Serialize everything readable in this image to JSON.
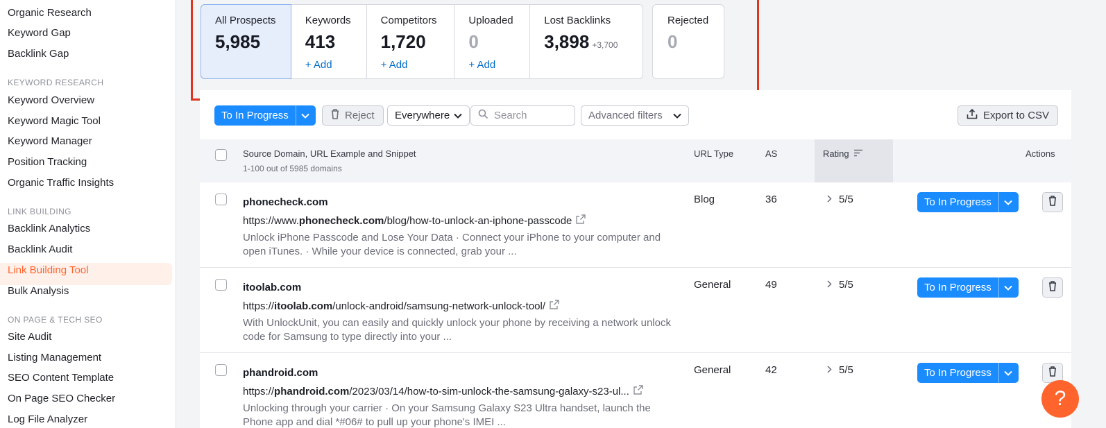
{
  "sidebar": {
    "items_top": [
      "Organic Research",
      "Keyword Gap",
      "Backlink Gap"
    ],
    "section_keyword": "KEYWORD RESEARCH",
    "items_keyword": [
      "Keyword Overview",
      "Keyword Magic Tool",
      "Keyword Manager",
      "Position Tracking",
      "Organic Traffic Insights"
    ],
    "section_link": "LINK BUILDING",
    "items_link": [
      "Backlink Analytics",
      "Backlink Audit",
      "Link Building Tool",
      "Bulk Analysis"
    ],
    "section_onpage": "ON PAGE & TECH SEO",
    "items_onpage": [
      "Site Audit",
      "Listing Management",
      "SEO Content Template",
      "On Page SEO Checker",
      "Log File Analyzer"
    ]
  },
  "tabs": [
    {
      "label": "All Prospects",
      "value": "5,985"
    },
    {
      "label": "Keywords",
      "value": "413",
      "add": "+ Add"
    },
    {
      "label": "Competitors",
      "value": "1,720",
      "add": "+ Add"
    },
    {
      "label": "Uploaded",
      "value": "0",
      "add": "+ Add"
    },
    {
      "label": "Lost Backlinks",
      "value": "3,898",
      "delta": "+3,700"
    },
    {
      "label": "Rejected",
      "value": "0"
    }
  ],
  "toolbar": {
    "to_in_progress": "To In Progress",
    "reject": "Reject",
    "everywhere": "Everywhere",
    "search_placeholder": "Search",
    "advanced_filters": "Advanced filters",
    "export": "Export to CSV"
  },
  "table": {
    "col_source": "Source Domain, URL Example and Snippet",
    "col_source_sub": "1-100 out of 5985 domains",
    "col_urltype": "URL Type",
    "col_as": "AS",
    "col_rating": "Rating",
    "col_actions": "Actions",
    "rows": [
      {
        "domain": "phonecheck.com",
        "url_prefix": "https://www.",
        "url_domain": "phonecheck.com",
        "url_path": "/blog/how-to-unlock-an-iphone-passcode",
        "snippet": "Unlock iPhone Passcode and Lose Your Data · Connect your iPhone to your computer and open iTunes. · While your device is connected, grab your ...",
        "url_type": "Blog",
        "as": "36",
        "rating": "5/5",
        "action": "To In Progress"
      },
      {
        "domain": "itoolab.com",
        "url_prefix": "https://",
        "url_domain": "itoolab.com",
        "url_path": "/unlock-android/samsung-network-unlock-tool/",
        "snippet": "With UnlockUnit, you can easily and quickly unlock your phone by receiving a network unlock code for Samsung to type directly into your ...",
        "url_type": "General",
        "as": "49",
        "rating": "5/5",
        "action": "To In Progress"
      },
      {
        "domain": "phandroid.com",
        "url_prefix": "https://",
        "url_domain": "phandroid.com",
        "url_path": "/2023/03/14/how-to-sim-unlock-the-samsung-galaxy-s23-ul...",
        "snippet": "Unlocking through your carrier · On your Samsung Galaxy S23 Ultra handset, launch the Phone app and dial *#06# to pull up your phone's IMEI ...",
        "url_type": "General",
        "as": "42",
        "rating": "5/5",
        "action": "To In Progress"
      }
    ]
  },
  "help": "?",
  "colors": {
    "accent": "#1a8cff",
    "brand": "#ff642d",
    "highlight": "#e0341e"
  }
}
